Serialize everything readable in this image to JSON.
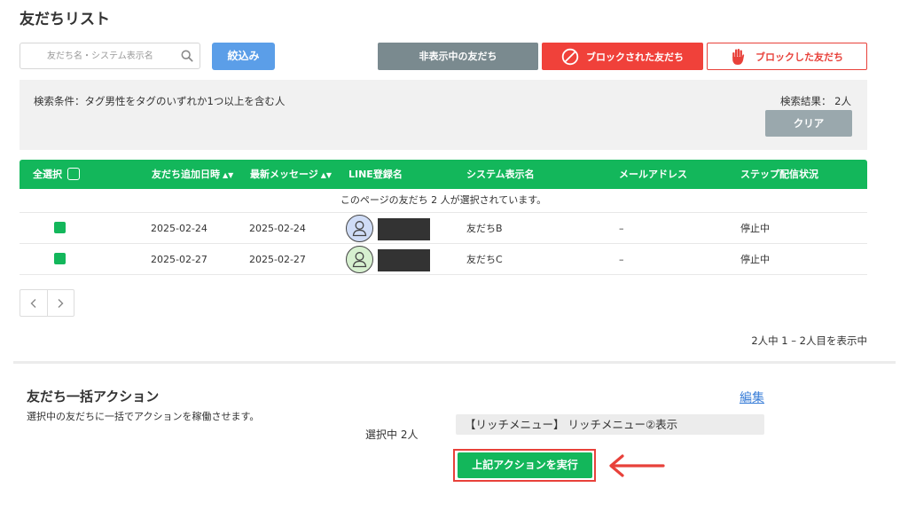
{
  "page": {
    "title": "友だちリスト"
  },
  "search": {
    "placeholder": "友だち名・システム表示名",
    "value": ""
  },
  "filter_button": "絞込み",
  "top_actions": {
    "hidden_label": "非表示中の友だち",
    "blocked_label": "ブロックされた友だち",
    "blocking_label": "ブロックした友だち"
  },
  "conditions": {
    "text": "検索条件：タグ男性をタグのいずれか1つ以上を含む人",
    "result": "検索結果： 2人",
    "clear_button": "クリア"
  },
  "table": {
    "headers": {
      "select_all": "全選択",
      "added_at": "友だち追加日時",
      "latest_message": "最新メッセージ",
      "line_name": "LINE登録名",
      "system_name": "システム表示名",
      "email": "メールアドレス",
      "step_status": "ステップ配信状況"
    },
    "selection_info": "このページの友だち 2 人が選択されています。",
    "rows": [
      {
        "added_at": "2025-02-24",
        "latest_message": "2025-02-24",
        "system_name": "友だちB",
        "email": "–",
        "step_status": "停止中",
        "avatar_color": "#cfdcf6",
        "checked": true
      },
      {
        "added_at": "2025-02-27",
        "latest_message": "2025-02-27",
        "system_name": "友だちC",
        "email": "–",
        "step_status": "停止中",
        "avatar_color": "#d6f0cf",
        "checked": true
      }
    ]
  },
  "pagination": {
    "prev_icon": "chevron-left-icon",
    "next_icon": "chevron-right-icon"
  },
  "range_info": "2人中 1 – 2人目を表示中",
  "bulk": {
    "title": "友だち一括アクション",
    "description": "選択中の友だちに一括でアクションを稼働させます。",
    "edit_link": "編集",
    "selected_count": "選択中 2人",
    "action_text": "【リッチメニュー】 リッチメニュー②表示",
    "run_button": "上記アクションを実行"
  },
  "colors": {
    "green": "#13b75b",
    "blue_button": "#5b9ee8",
    "gray_button": "#7a8a8f",
    "red": "#f0413a"
  }
}
